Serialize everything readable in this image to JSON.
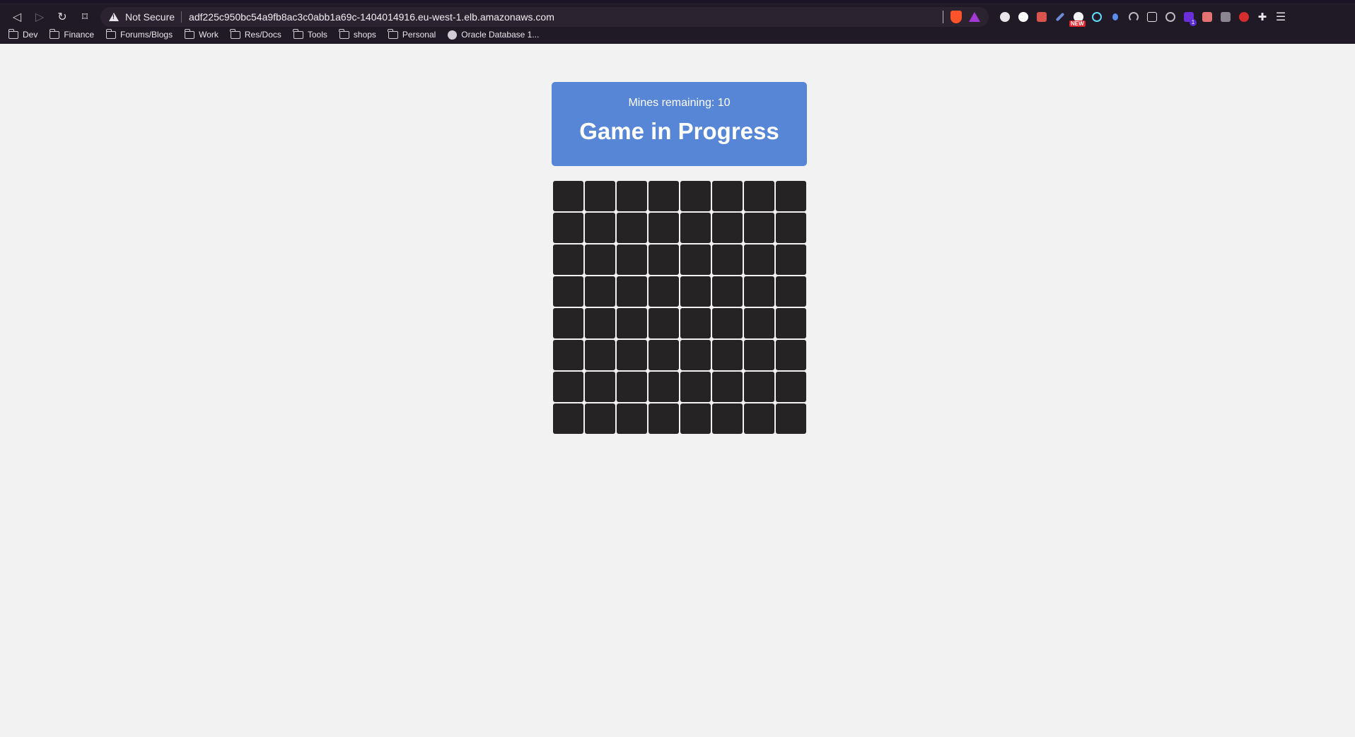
{
  "browser": {
    "url_warning": "Not Secure",
    "url": "adf225c950bc54a9fb8ac3c0abb1a69c-1404014916.eu-west-1.elb.amazonaws.com",
    "extension_badge_new": "NEW",
    "extension_badge_count": "1",
    "bookmarks": [
      {
        "label": "Dev",
        "icon": "folder-icon"
      },
      {
        "label": "Finance",
        "icon": "folder-icon"
      },
      {
        "label": "Forums/Blogs",
        "icon": "folder-icon"
      },
      {
        "label": "Work",
        "icon": "folder-icon"
      },
      {
        "label": "Res/Docs",
        "icon": "folder-icon"
      },
      {
        "label": "Tools",
        "icon": "folder-icon"
      },
      {
        "label": "shops",
        "icon": "folder-icon"
      },
      {
        "label": "Personal",
        "icon": "folder-icon"
      },
      {
        "label": "Oracle Database 1...",
        "icon": "globe-icon"
      }
    ]
  },
  "game": {
    "mines_label": "Mines remaining: 10",
    "status": "Game in Progress",
    "status_color": "#5886d6",
    "cell_color": "#252324",
    "rows": 8,
    "cols": 8
  }
}
